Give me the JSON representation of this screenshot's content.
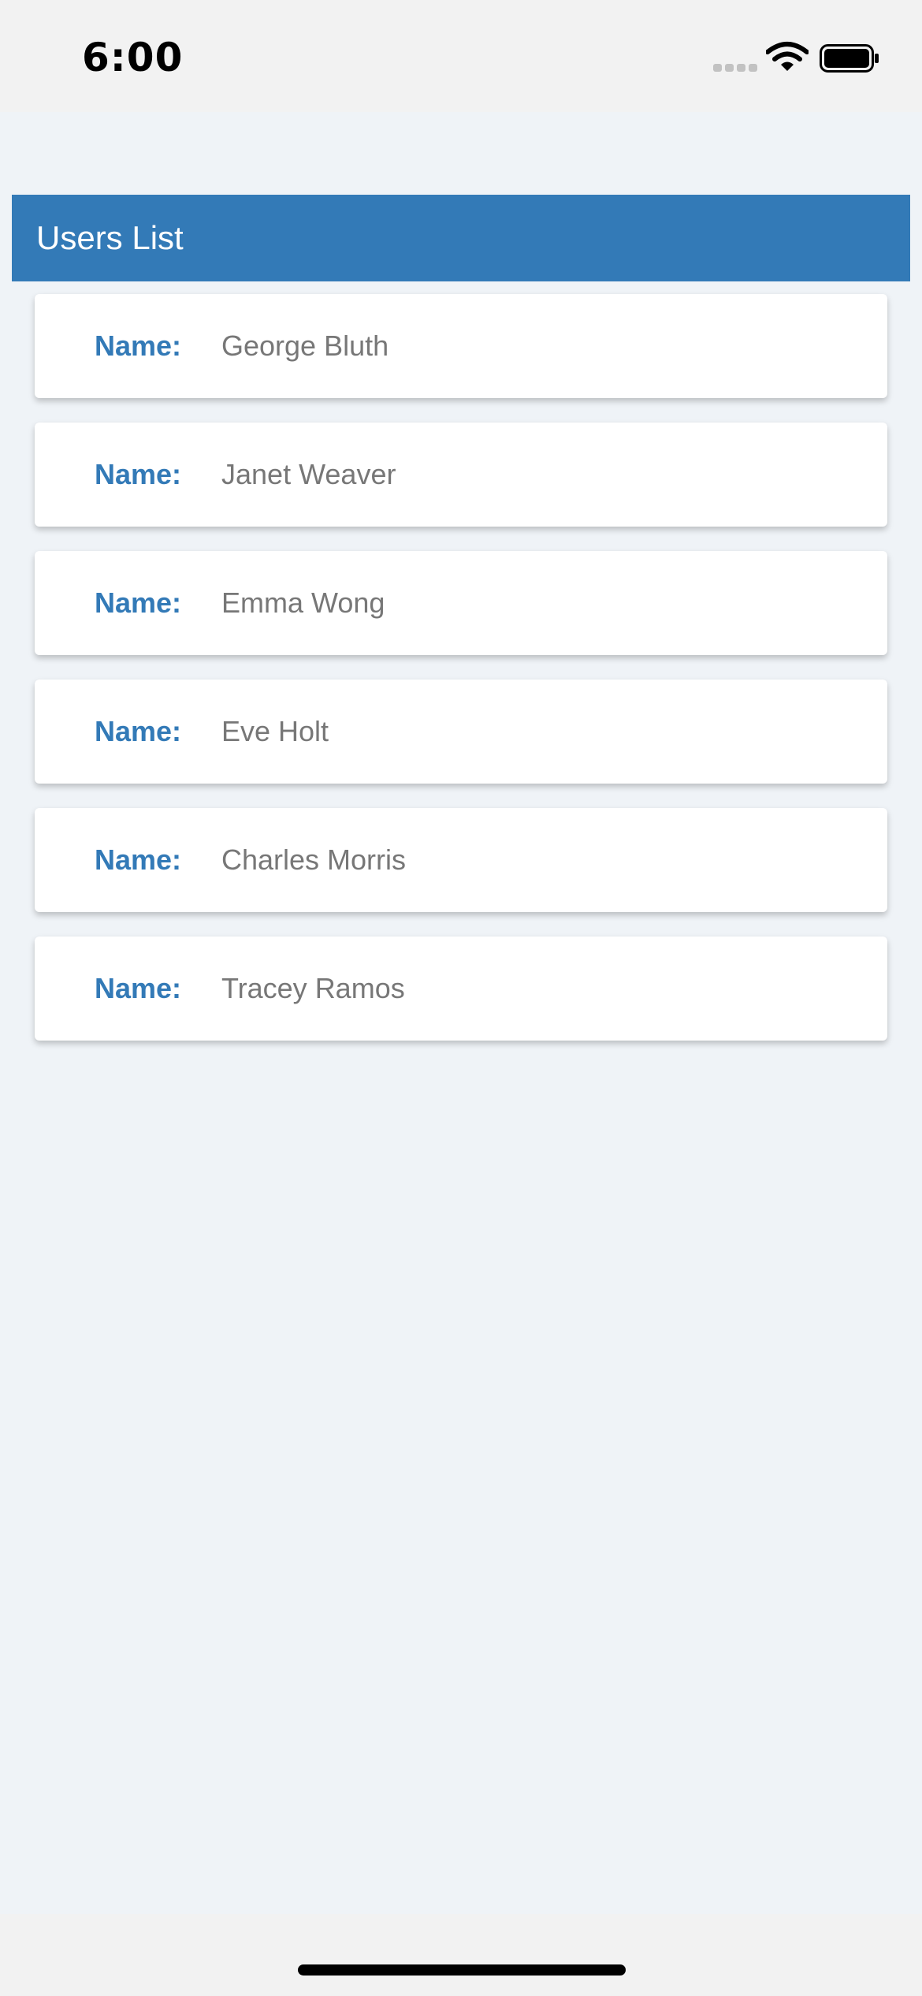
{
  "status_bar": {
    "time": "6:00"
  },
  "header": {
    "title": "Users List"
  },
  "users": [
    {
      "label": "Name:",
      "name": "George Bluth"
    },
    {
      "label": "Name:",
      "name": "Janet Weaver"
    },
    {
      "label": "Name:",
      "name": "Emma Wong"
    },
    {
      "label": "Name:",
      "name": "Eve Holt"
    },
    {
      "label": "Name:",
      "name": "Charles Morris"
    },
    {
      "label": "Name:",
      "name": "Tracey Ramos"
    }
  ],
  "colors": {
    "accent": "#337ab7",
    "background": "#eff3f7",
    "card": "#ffffff",
    "muted_text": "#777777"
  },
  "icons": [
    "signal-icon",
    "wifi-icon",
    "battery-icon"
  ]
}
